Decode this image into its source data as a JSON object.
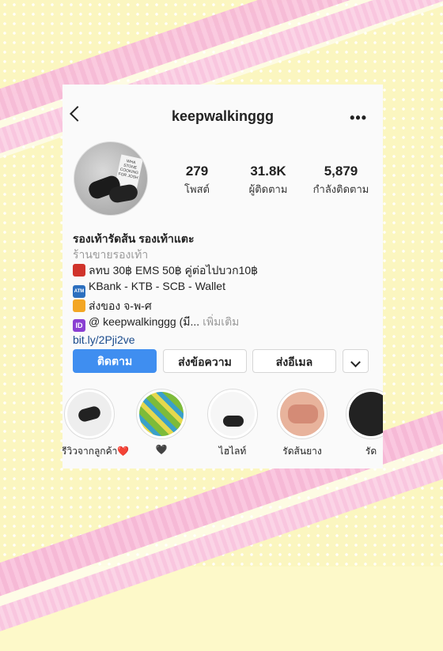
{
  "profile": {
    "username": "keepwalkinggg",
    "more_icon": "•••",
    "stats": [
      {
        "value": "279",
        "label": "โพสต์"
      },
      {
        "value": "31.8K",
        "label": "ผู้ติดตาม"
      },
      {
        "value": "5,879",
        "label": "กำลังติดตาม"
      }
    ],
    "bio": {
      "name": "รองเท้ารัดส้น รองเท้าแตะ",
      "category": "ร้านขายรองเท้า",
      "line1": "ลทบ 30฿ EMS 50฿ คู่ต่อไปบวก10฿",
      "line2": "KBank - KTB - SCB - Wallet",
      "line3": "ส่งของ จ-พ-ศ",
      "line4": "@ keepwalkinggg (มี...",
      "more": "เพิ่มเติม",
      "link": "bit.ly/2Pji2ve",
      "atm_label": "ATM",
      "id_label": "ID"
    },
    "avatar_text": "WHA STONE COOKING FOR JOSH"
  },
  "buttons": {
    "follow": "ติดตาม",
    "message": "ส่งข้อความ",
    "email": "ส่งอีเมล"
  },
  "highlights": [
    {
      "label": "รีวิวจากลูกค้า❤️"
    },
    {
      "label": "🖤"
    },
    {
      "label": "ไฮไลท์"
    },
    {
      "label": "รัดส้นยาง"
    },
    {
      "label": "รัด"
    }
  ],
  "colors": {
    "follow_button": "#3f8ef0",
    "link": "#1a4b8c"
  }
}
